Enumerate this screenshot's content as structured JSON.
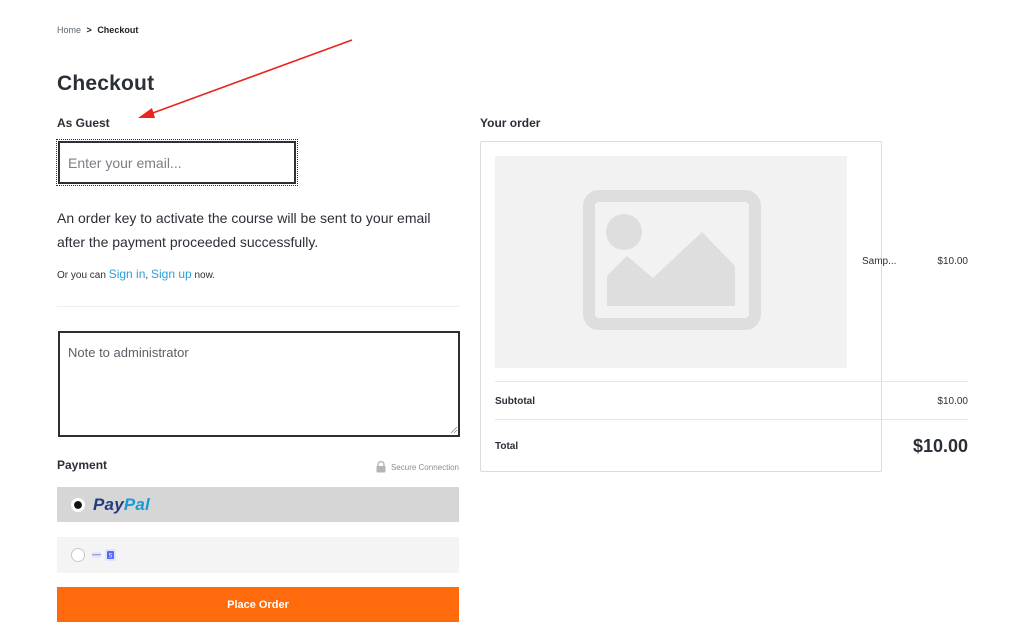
{
  "breadcrumb": {
    "home": "Home",
    "separator": ">",
    "current": "Checkout"
  },
  "page_title": "Checkout",
  "guest": {
    "label": "As Guest",
    "email_placeholder": "Enter your email...",
    "order_key_note": "An order key to activate the course will be sent to your email after the payment proceeded successfully.",
    "signin_prefix": "Or you can",
    "signin_link": "Sign in",
    "signin_comma": ",",
    "signup_link": "Sign up",
    "signin_suffix": "now."
  },
  "admin_note_placeholder": "Note to administrator",
  "payment": {
    "label": "Payment",
    "secure_text": "Secure Connection",
    "methods": [
      {
        "name_part1": "Pay",
        "name_part2": "Pal",
        "selected": true
      },
      {
        "icon": "card-icon",
        "selected": false
      }
    ],
    "place_order": "Place Order"
  },
  "order": {
    "label": "Your order",
    "item": {
      "name": "Samp...",
      "price": "$10.00",
      "thumbnail_icon": "image-placeholder-icon"
    },
    "subtotal_label": "Subtotal",
    "subtotal_value": "$10.00",
    "total_label": "Total",
    "total_value": "$10.00"
  },
  "colors": {
    "accent": "#ff6a0c",
    "link": "#2a9fd8",
    "annotation": "#e8261e"
  }
}
